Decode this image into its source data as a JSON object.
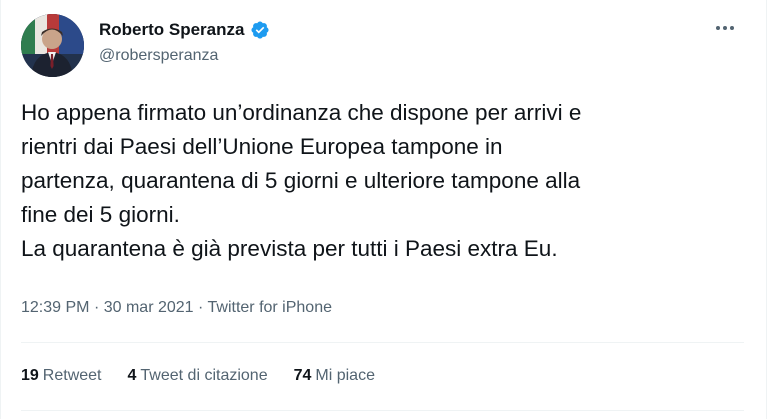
{
  "author": {
    "display_name": "Roberto Speranza",
    "handle": "@robersperanza",
    "verified": true,
    "verified_color": "#1d9bf0"
  },
  "tweet": {
    "text": "Ho appena firmato un’ordinanza che dispone per arrivi e\nrientri dai Paesi dell’Unione Europea tampone in\npartenza, quarantena di 5 giorni e ulteriore tampone alla\nfine dei 5 giorni.\nLa quarantena è già prevista per tutti i Paesi extra Eu.",
    "time": "12:39 PM",
    "separator": "·",
    "date": "30 mar 2021",
    "source": "Twitter for iPhone"
  },
  "stats": {
    "retweets": {
      "count": "19",
      "label": "Retweet"
    },
    "quotes": {
      "count": "4",
      "label": "Tweet di citazione"
    },
    "likes": {
      "count": "74",
      "label": "Mi piace"
    }
  },
  "icons": {
    "more": "more-horizontal-icon",
    "verified": "verified-badge-icon"
  }
}
